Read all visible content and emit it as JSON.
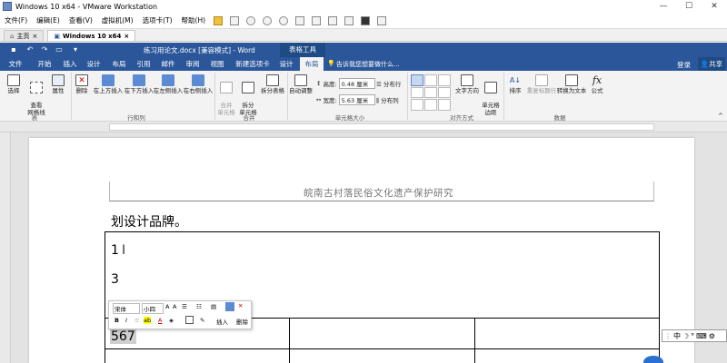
{
  "vmware": {
    "window_title": "Windows 10 x64 - VMware Workstation",
    "menu": [
      "文件(F)",
      "编辑(E)",
      "查看(V)",
      "虚拟机(M)",
      "选项卡(T)",
      "帮助(H)"
    ],
    "tabs": [
      {
        "label": "主页"
      },
      {
        "label": "Windows 10 x64"
      }
    ]
  },
  "word": {
    "title": "练习用论文.docx [兼容模式] - Word",
    "context_tool": "表格工具",
    "tabs": [
      "文件",
      "开始",
      "插入",
      "设计",
      "布局",
      "引用",
      "邮件",
      "审阅",
      "视图",
      "新建选项卡",
      "设计",
      "布局"
    ],
    "tell_me": "告诉我您想要做什么...",
    "login": "登录",
    "share": "共享",
    "ribbon": {
      "groups": [
        "表",
        "行和列",
        "合并",
        "单元格大小",
        "对齐方式",
        "数据"
      ],
      "buttons": {
        "select": "选择",
        "gridlines": "查看\n网格线",
        "properties": "属性",
        "delete": "删除",
        "insert_above": "在上方插入",
        "insert_below": "在下方插入",
        "insert_left": "在左侧插入",
        "insert_right": "在右侧插入",
        "merge_cells": "合并\n单元格",
        "split_cells": "拆分\n单元格",
        "split_table": "拆分表格",
        "autofit": "自动调整",
        "height_label": "高度:",
        "height_value": "0.48 厘米",
        "width_label": "宽度:",
        "width_value": "5.63 厘米",
        "distribute_rows": "分布行",
        "distribute_cols": "分布列",
        "text_direction": "文字方向",
        "cell_margins": "单元格\n边距",
        "sort": "排序",
        "repeat_header": "重复标题行",
        "convert_text": "转换为文本",
        "formula": "公式"
      }
    },
    "document": {
      "header_text": "皖南古村落民俗文化遗产保护研究",
      "line1": "划设计品牌。",
      "cell_line1": "1",
      "cell_line2": "3",
      "cell_567": "567"
    },
    "mini_toolbar": {
      "font": "宋体",
      "size": "小四",
      "insert": "插入",
      "delete": "删除"
    },
    "ime": "中"
  },
  "colors": {
    "word_blue": "#2b579a",
    "ribbon_bg": "#f3f3f3"
  }
}
